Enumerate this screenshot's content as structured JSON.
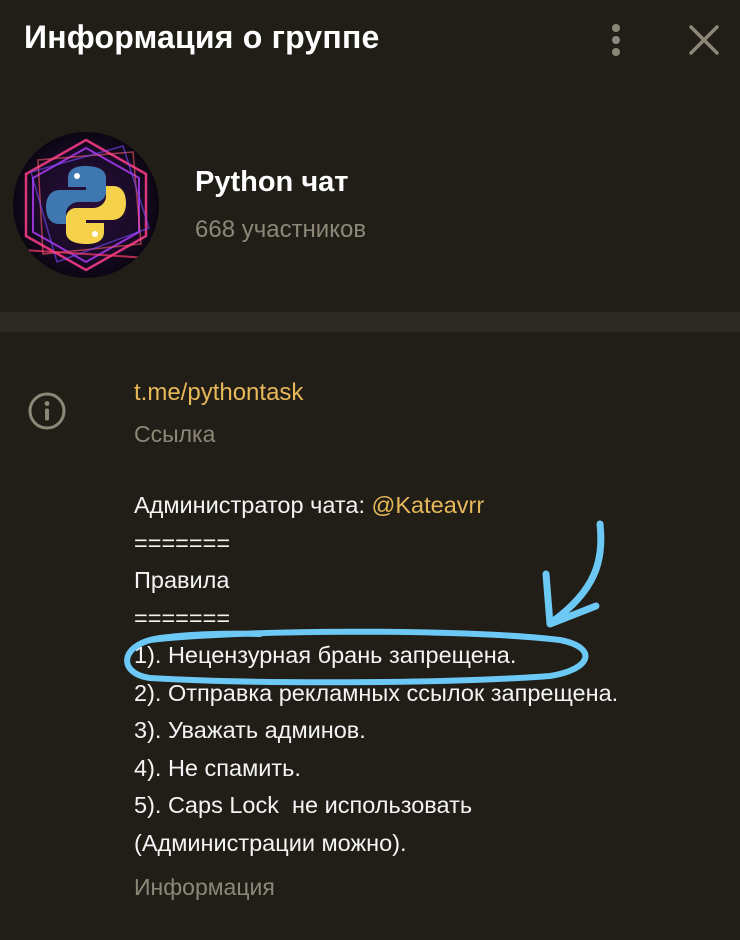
{
  "header": {
    "title": "Информация о группе",
    "menu_icon": "more-vertical-icon",
    "close_icon": "close-icon"
  },
  "profile": {
    "name": "Python чат",
    "members": "668 участников",
    "avatar_icon": "python-logo-icon"
  },
  "info": {
    "icon": "info-icon",
    "link": "t.me/pythontask",
    "link_caption": "Ссылка",
    "about": {
      "admin_prefix": "Администратор чата: ",
      "admin_handle": "@Kateavrr",
      "separator_1": "=======",
      "rules_heading": "Правила",
      "separator_2": "=======",
      "rule_1": "1). Нецензурная брань запрещена.",
      "rule_2": "2). Отправка рекламных ссылок запрещена.",
      "rule_3": "3). Уважать админов.",
      "rule_4": "4). Не спамить.",
      "rule_5": "5). Caps Lock  не использовать",
      "rule_5_cont": "(Администрации можно)."
    },
    "about_caption": "Информация"
  },
  "colors": {
    "background": "#211e18",
    "divider": "#2c2922",
    "accent_link": "#e7b85a",
    "secondary_text": "#8d8778",
    "annotation": "#6cc8f4"
  }
}
